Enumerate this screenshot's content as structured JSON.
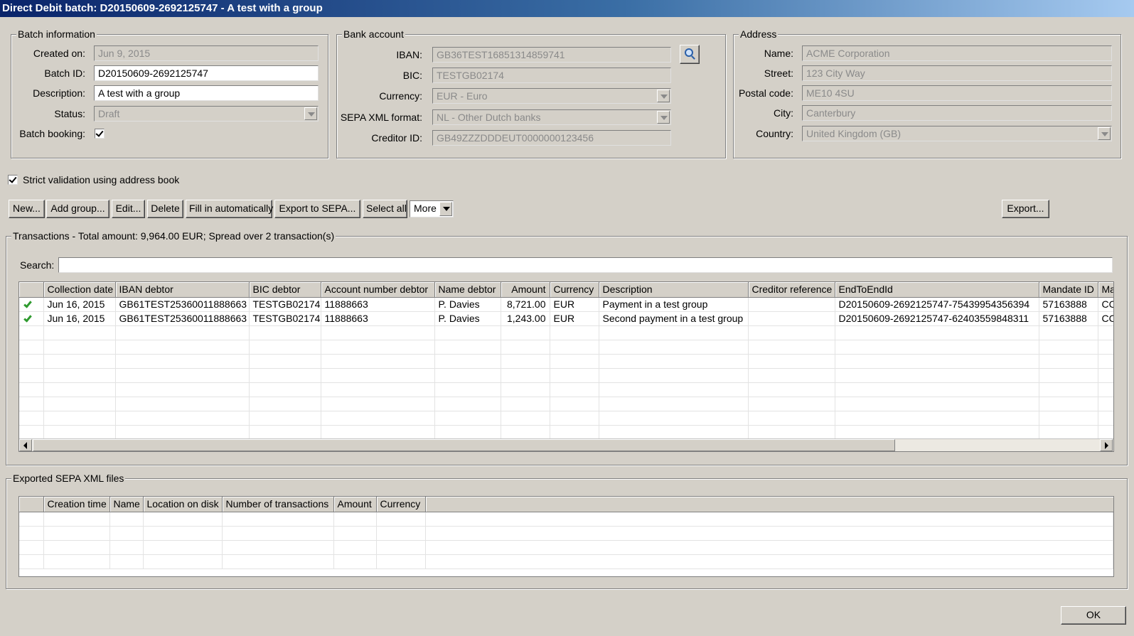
{
  "window": {
    "title": "Direct Debit batch: D20150609-2692125747 - A test with a group"
  },
  "batch": {
    "legend": "Batch information",
    "created_label": "Created on:",
    "created_value": "Jun 9, 2015",
    "id_label": "Batch ID:",
    "id_value": "D20150609-2692125747",
    "desc_label": "Description:",
    "desc_value": "A test with a group",
    "status_label": "Status:",
    "status_value": "Draft",
    "booking_label": "Batch booking:",
    "booking_checked": true
  },
  "bank": {
    "legend": "Bank account",
    "iban_label": "IBAN:",
    "iban_value": "GB36TEST16851314859741",
    "bic_label": "BIC:",
    "bic_value": "TESTGB02174",
    "currency_label": "Currency:",
    "currency_value": "EUR - Euro",
    "format_label": "SEPA XML format:",
    "format_value": "NL - Other Dutch banks",
    "creditor_label": "Creditor ID:",
    "creditor_value": "GB49ZZZDDDEUT0000000123456"
  },
  "address": {
    "legend": "Address",
    "name_label": "Name:",
    "name_value": "ACME Corporation",
    "street_label": "Street:",
    "street_value": "123 City Way",
    "postal_label": "Postal code:",
    "postal_value": "ME10 4SU",
    "city_label": "City:",
    "city_value": "Canterbury",
    "country_label": "Country:",
    "country_value": "United Kingdom (GB)"
  },
  "strict_validation": {
    "label": "Strict validation using address book",
    "checked": true
  },
  "toolbar": {
    "new": "New...",
    "add_group": "Add group...",
    "edit": "Edit...",
    "delete": "Delete",
    "fill": "Fill in automatically",
    "export_sepa": "Export to SEPA...",
    "select_all": "Select all",
    "more": "More",
    "export": "Export..."
  },
  "transactions": {
    "legend": "Transactions - Total amount: 9,964.00 EUR; Spread over 2 transaction(s)",
    "search_label": "Search:",
    "search_value": "",
    "columns": [
      "Collection date",
      "IBAN debtor",
      "BIC debtor",
      "Account number debtor",
      "Name debtor",
      "Amount",
      "Currency",
      "Description",
      "Creditor reference",
      "EndToEndId",
      "Mandate ID",
      "Ma"
    ],
    "rows": [
      {
        "date": "Jun 16, 2015",
        "iban": "GB61TEST25360011888663",
        "bic": "TESTGB02174",
        "account": "11888663",
        "name": "P. Davies",
        "amount": "8,721.00",
        "currency": "EUR",
        "description": "Payment in a test group",
        "creditor_ref": "",
        "e2e": "D20150609-2692125747-75439954356394",
        "mandate": "57163888",
        "ma": "CC"
      },
      {
        "date": "Jun 16, 2015",
        "iban": "GB61TEST25360011888663",
        "bic": "TESTGB02174",
        "account": "11888663",
        "name": "P. Davies",
        "amount": "1,243.00",
        "currency": "EUR",
        "description": "Second payment in a test group",
        "creditor_ref": "",
        "e2e": "D20150609-2692125747-62403559848311",
        "mandate": "57163888",
        "ma": "CC"
      }
    ]
  },
  "exported": {
    "legend": "Exported SEPA XML files",
    "columns": [
      "Creation time",
      "Name",
      "Location on disk",
      "Number of transactions",
      "Amount",
      "Currency"
    ]
  },
  "ok": "OK",
  "icons": {
    "valid": "check-icon",
    "lookup": "search-icon"
  },
  "colors": {
    "title_bar": "#0a246a",
    "check": "#2e9a2e",
    "window_bg": "#d4d0c8"
  }
}
